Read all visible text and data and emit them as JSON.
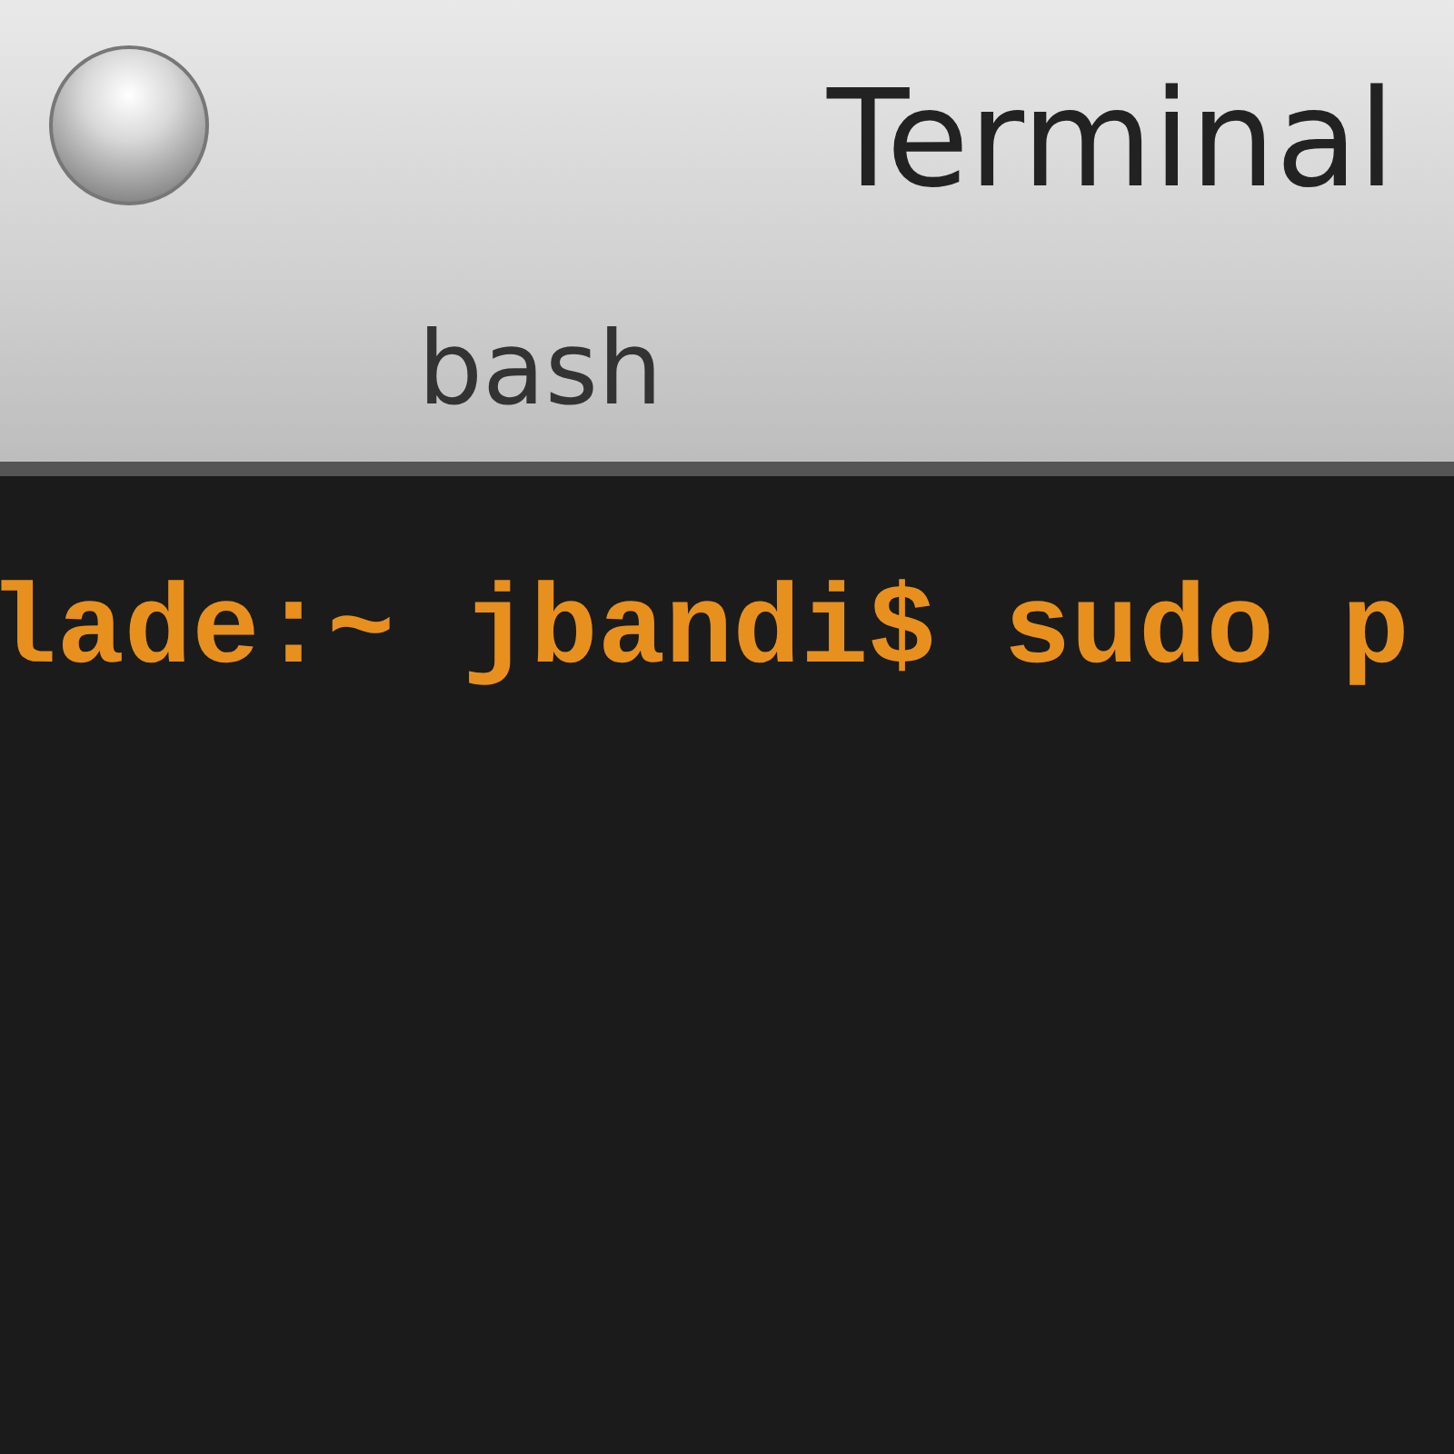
{
  "window": {
    "title": "Terminal"
  },
  "tab": {
    "label": "bash"
  },
  "terminal": {
    "lines": [
      "lade:~ jbandi$ sudo p"
    ]
  }
}
